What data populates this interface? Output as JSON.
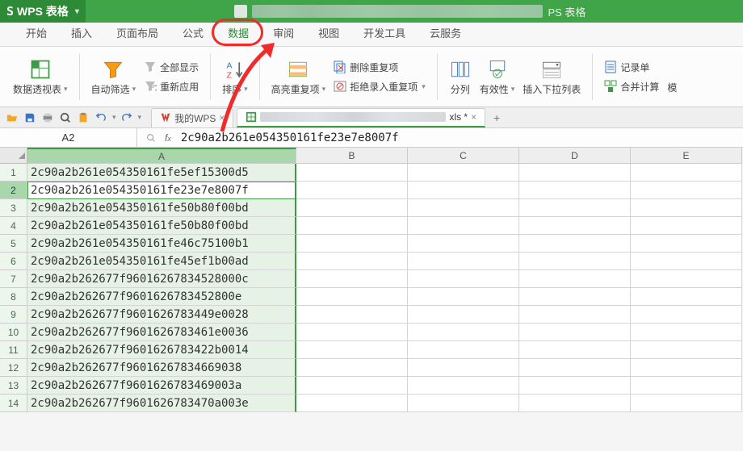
{
  "app": {
    "badge_prefix": "S",
    "name": "WPS 表格",
    "title_suffix": "PS 表格"
  },
  "tabs": {
    "items": [
      "开始",
      "插入",
      "页面布局",
      "公式",
      "数据",
      "审阅",
      "视图",
      "开发工具",
      "云服务"
    ],
    "active_index": 4
  },
  "ribbon": {
    "pivot": "数据透视表",
    "autofilter": "自动筛选",
    "show_all": "全部显示",
    "reapply": "重新应用",
    "sort": "排序",
    "highlight_dup": "高亮重复项",
    "delete_dup": "删除重复项",
    "reject_dup": "拒绝录入重复项",
    "split": "分列",
    "validation": "有效性",
    "dropdown": "插入下拉列表",
    "form": "记录单",
    "consolidate": "合并计算",
    "model_partial": "模"
  },
  "quick_access_icons": [
    "open",
    "save",
    "print",
    "preview",
    "paste",
    "undo",
    "redo"
  ],
  "doc_tabs": {
    "wps_tab": "我的WPS",
    "active_suffix": "xls *",
    "active_close": "×"
  },
  "namebox": "A2",
  "formula": "2c90a2b261e054350161fe23e7e8007f",
  "columns": [
    "A",
    "B",
    "C",
    "D",
    "E"
  ],
  "cells": {
    "A": [
      "2c90a2b261e054350161fe5ef15300d5",
      "2c90a2b261e054350161fe23e7e8007f",
      "2c90a2b261e054350161fe50b80f00bd",
      "2c90a2b261e054350161fe50b80f00bd",
      "2c90a2b261e054350161fe46c75100b1",
      "2c90a2b261e054350161fe45ef1b00ad",
      "2c90a2b262677f96016267834528000c",
      "2c90a2b262677f9601626783452800e",
      "2c90a2b262677f9601626783449e0028",
      "2c90a2b262677f9601626783461e0036",
      "2c90a2b262677f9601626783422b0014",
      "2c90a2b262677f96016267834669038",
      "2c90a2b262677f9601626783469003a",
      "2c90a2b262677f9601626783470a003e"
    ],
    "active_row": 2
  }
}
